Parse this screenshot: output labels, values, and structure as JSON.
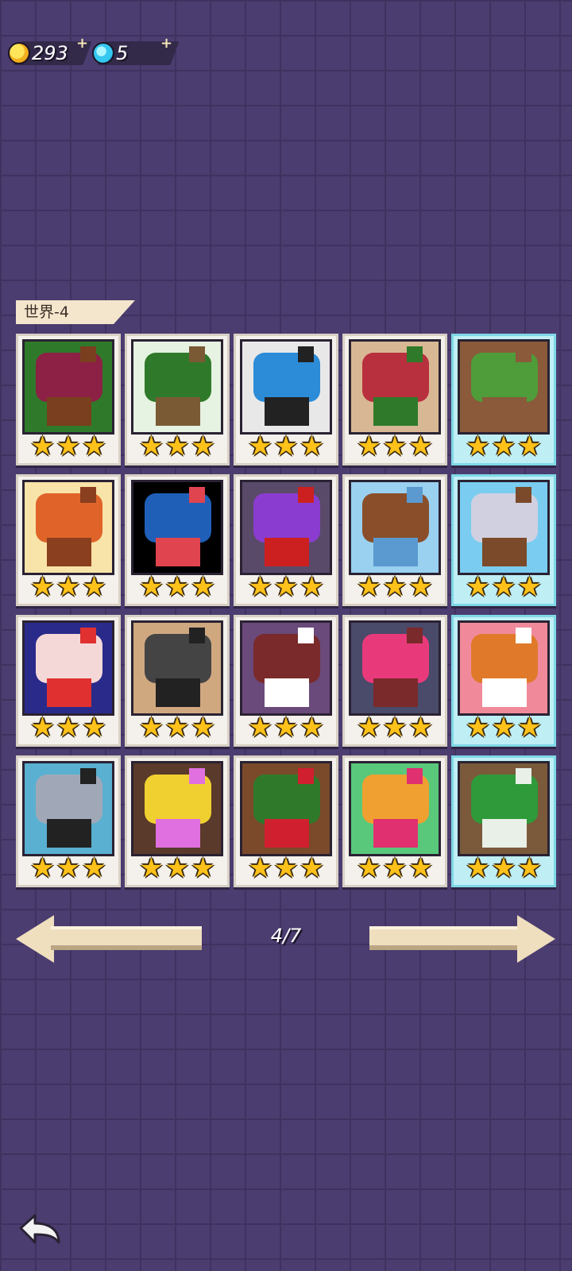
{
  "currency": {
    "coins": "293",
    "gems": "5",
    "coin_plus": "+",
    "gem_plus": "+"
  },
  "world": {
    "label": "世界-4"
  },
  "levels": [
    {
      "stars": 3,
      "cleared": false,
      "art": [
        "#2f7a2a",
        "#8c2045",
        "#7a3f1e"
      ]
    },
    {
      "stars": 3,
      "cleared": false,
      "art": [
        "#e6f2e2",
        "#2f7a2a",
        "#7a5a35"
      ]
    },
    {
      "stars": 3,
      "cleared": false,
      "art": [
        "#e8e8e8",
        "#2c8cd8",
        "#222222"
      ]
    },
    {
      "stars": 3,
      "cleared": false,
      "art": [
        "#d8b894",
        "#b8303e",
        "#2f7a2a"
      ]
    },
    {
      "stars": 3,
      "cleared": true,
      "art": [
        "#8a5a3a",
        "#4f9c3a",
        "#8a5a3a"
      ]
    },
    {
      "stars": 3,
      "cleared": false,
      "art": [
        "#f8e3a8",
        "#e0642a",
        "#8a3f1e"
      ]
    },
    {
      "stars": 3,
      "cleared": false,
      "art": [
        "#000000",
        "#1f5fb8",
        "#e0444f"
      ]
    },
    {
      "stars": 3,
      "cleared": false,
      "art": [
        "#5a4a6a",
        "#8a3cd0",
        "#cc2020"
      ]
    },
    {
      "stars": 3,
      "cleared": false,
      "art": [
        "#9ad0f0",
        "#8a4f2a",
        "#5a9ad0"
      ]
    },
    {
      "stars": 3,
      "cleared": true,
      "art": [
        "#7acdf0",
        "#d0d0e0",
        "#7a4a2a"
      ]
    },
    {
      "stars": 3,
      "cleared": false,
      "art": [
        "#2a2a8a",
        "#f4d8d8",
        "#e03030"
      ]
    },
    {
      "stars": 3,
      "cleared": false,
      "art": [
        "#d0a880",
        "#444444",
        "#222222"
      ]
    },
    {
      "stars": 3,
      "cleared": false,
      "art": [
        "#6a4a7a",
        "#7a2a2a",
        "#ffffff"
      ]
    },
    {
      "stars": 3,
      "cleared": false,
      "art": [
        "#4a4a6a",
        "#e83a7a",
        "#7a2a2a"
      ]
    },
    {
      "stars": 3,
      "cleared": true,
      "art": [
        "#f08a9a",
        "#e07a2a",
        "#ffffff"
      ]
    },
    {
      "stars": 3,
      "cleared": false,
      "art": [
        "#5ab0d0",
        "#a0a8b8",
        "#222222"
      ]
    },
    {
      "stars": 3,
      "cleared": false,
      "art": [
        "#5a3a2a",
        "#f0d030",
        "#e070e0"
      ]
    },
    {
      "stars": 3,
      "cleared": false,
      "art": [
        "#7a4a2a",
        "#2f7a2a",
        "#d02030"
      ]
    },
    {
      "stars": 3,
      "cleared": false,
      "art": [
        "#5ac87a",
        "#f0a030",
        "#e03070"
      ]
    },
    {
      "stars": 3,
      "cleared": true,
      "art": [
        "#7a5a3a",
        "#2f9a3a",
        "#e8f0e8"
      ]
    }
  ],
  "pagination": {
    "text": "4/7"
  },
  "colors": {
    "background": "#4b3d70",
    "star": "#ffc21a",
    "cleared_card": "#bfeff5"
  }
}
